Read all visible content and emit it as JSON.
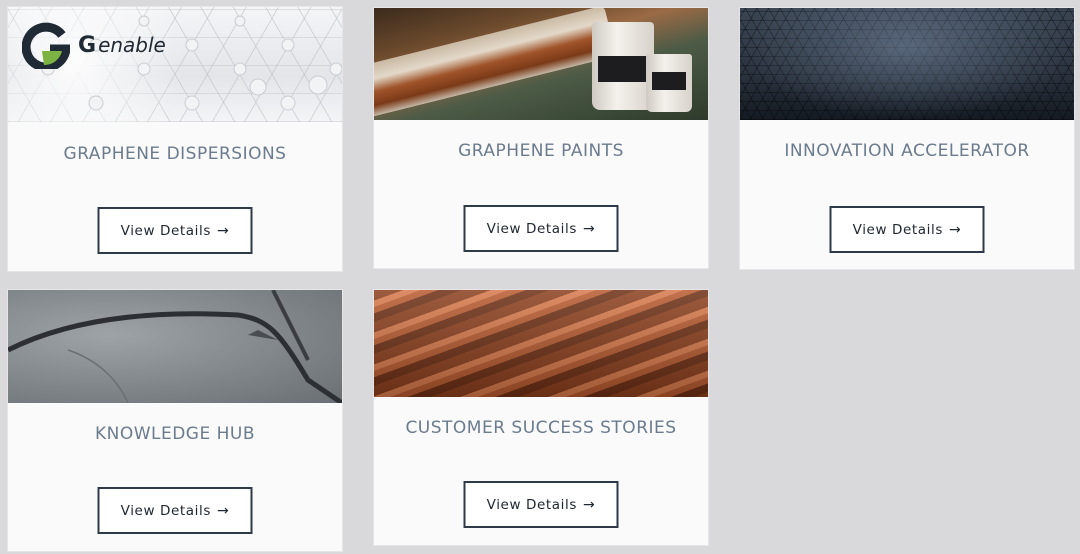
{
  "logo": {
    "g_letter": "G",
    "wordmark": "enable"
  },
  "cards": [
    {
      "title": "GRAPHENE DISPERSIONS",
      "button_label": "View Details",
      "arrow": "→",
      "image": "graphene-lattice-image"
    },
    {
      "title": "GRAPHENE PAINTS",
      "button_label": "View Details",
      "arrow": "→",
      "image": "rusty-rail-paint-tins-image"
    },
    {
      "title": "INNOVATION ACCELERATOR",
      "button_label": "View Details",
      "arrow": "→",
      "image": "hexagon-texture-image"
    },
    {
      "title": "KNOWLEDGE HUB",
      "button_label": "View Details",
      "arrow": "→",
      "image": "microscopy-image"
    },
    {
      "title": "CUSTOMER SUCCESS STORIES",
      "button_label": "View Details",
      "arrow": "→",
      "image": "corrugated-metal-image"
    }
  ],
  "colors": {
    "page_bg": "#d9d9dc",
    "card_bg": "#fafafa",
    "title": "#6b7b8e",
    "button_border": "#2f3a48"
  }
}
